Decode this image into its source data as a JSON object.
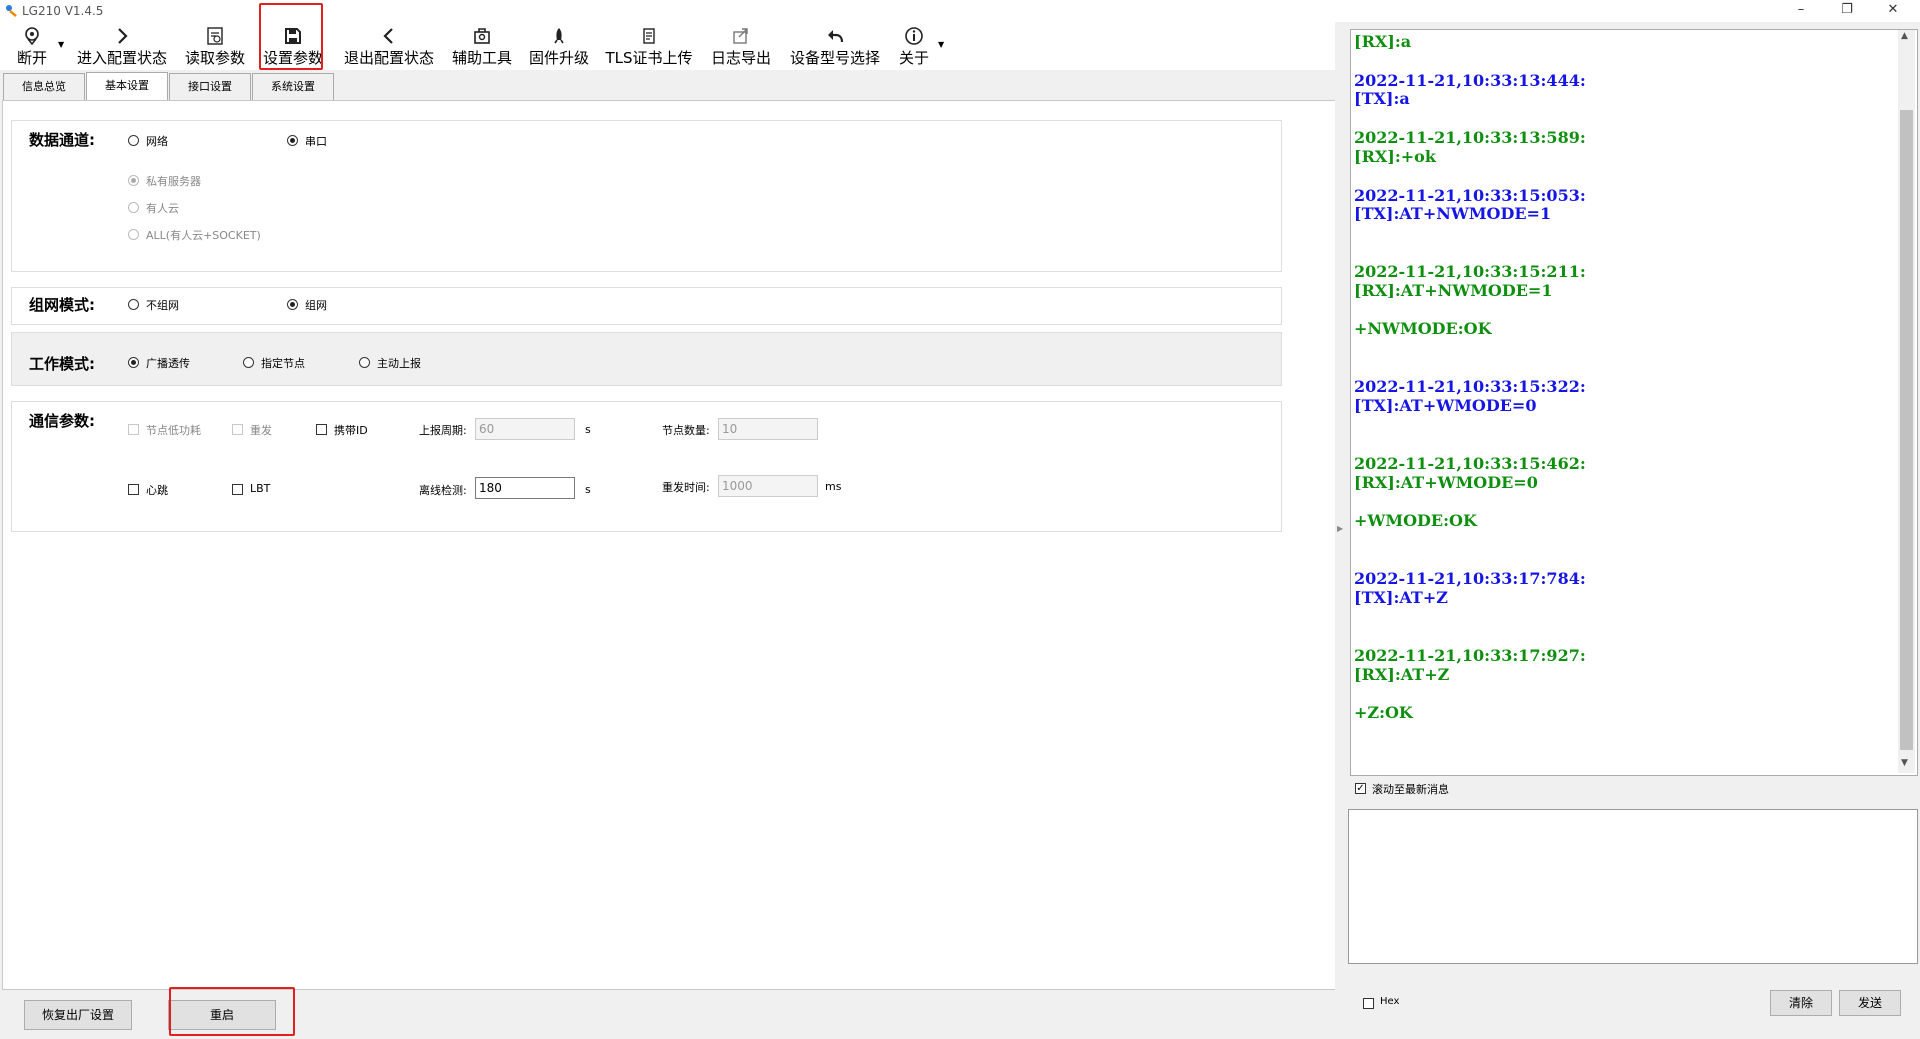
{
  "window": {
    "title": "LG210 V1.4.5"
  },
  "toolbar": {
    "disconnect": "断开",
    "enter_config": "进入配置状态",
    "read_params": "读取参数",
    "set_params": "设置参数",
    "exit_config": "退出配置状态",
    "tools": "辅助工具",
    "firmware": "固件升级",
    "tls": "TLS证书上传",
    "log_export": "日志导出",
    "device_model": "设备型号选择",
    "about": "关于"
  },
  "tabs": [
    "信息总览",
    "基本设置",
    "接口设置",
    "系统设置"
  ],
  "data_channel": {
    "label": "数据通道:",
    "network": "网络",
    "serial": "串口",
    "private_server": "私有服务器",
    "usr_cloud": "有人云",
    "all": "ALL(有人云+SOCKET)"
  },
  "network_mode": {
    "label": "组网模式:",
    "no_network": "不组网",
    "network": "组网"
  },
  "work_mode": {
    "label": "工作模式:",
    "broadcast": "广播透传",
    "node": "指定节点",
    "report": "主动上报"
  },
  "comm_params": {
    "label": "通信参数:",
    "low_power": "节点低功耗",
    "resend": "重发",
    "carry_id": "携带ID",
    "report_period_label": "上报周期:",
    "report_period": "60",
    "report_unit": "s",
    "node_count_label": "节点数量:",
    "node_count": "10",
    "heartbeat": "心跳",
    "lbt": "LBT",
    "offline_label": "离线检测:",
    "offline": "180",
    "offline_unit": "s",
    "resend_time_label": "重发时间:",
    "resend_time": "1000",
    "resend_unit": "ms"
  },
  "bottom": {
    "factory_reset": "恢复出厂设置",
    "restart": "重启"
  },
  "log": [
    {
      "text": "[RX]:a",
      "kind": "rx"
    },
    {
      "text": "2022-11-21,10:33:13:444:",
      "kind": "tx"
    },
    {
      "text": "[TX]:a",
      "kind": "tx"
    },
    {
      "text": "2022-11-21,10:33:13:589:",
      "kind": "rx"
    },
    {
      "text": "[RX]:+ok",
      "kind": "rx"
    },
    {
      "text": "2022-11-21,10:33:15:053:",
      "kind": "tx"
    },
    {
      "text": "[TX]:AT+NWMODE=1",
      "kind": "tx"
    },
    {
      "text": "2022-11-21,10:33:15:211:",
      "kind": "rx"
    },
    {
      "text": "[RX]:AT+NWMODE=1",
      "kind": "rx"
    },
    {
      "text": "+NWMODE:OK",
      "kind": "rx"
    },
    {
      "text": "2022-11-21,10:33:15:322:",
      "kind": "tx"
    },
    {
      "text": "[TX]:AT+WMODE=0",
      "kind": "tx"
    },
    {
      "text": "2022-11-21,10:33:15:462:",
      "kind": "rx"
    },
    {
      "text": "[RX]:AT+WMODE=0",
      "kind": "rx"
    },
    {
      "text": "+WMODE:OK",
      "kind": "rx"
    },
    {
      "text": "2022-11-21,10:33:17:784:",
      "kind": "tx"
    },
    {
      "text": "[TX]:AT+Z",
      "kind": "tx"
    },
    {
      "text": "2022-11-21,10:33:17:927:",
      "kind": "rx"
    },
    {
      "text": "[RX]:AT+Z",
      "kind": "rx"
    },
    {
      "text": "+Z:OK",
      "kind": "rx"
    }
  ],
  "right": {
    "autoscroll": "滚动至最新消息",
    "hex": "Hex",
    "clear": "清除",
    "send": "发送"
  },
  "colors": {
    "tx": "#1515e6",
    "rx": "#0f8f0f",
    "highlight": "#e02020"
  }
}
